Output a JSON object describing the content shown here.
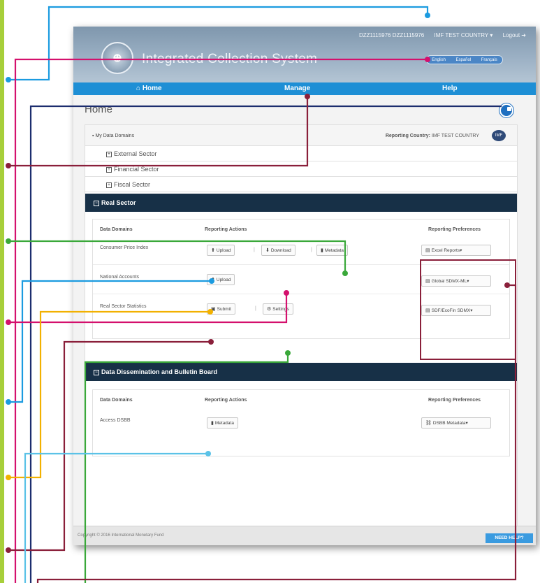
{
  "header": {
    "user_id": "DZZ1115976 DZZ1115976",
    "country_menu": "IMF TEST COUNTRY",
    "logout": "Logout",
    "app_title": "Integrated Collection System",
    "languages": [
      "English",
      "Español",
      "Français"
    ]
  },
  "nav": {
    "home": "Home",
    "manage": "Manage",
    "help": "Help"
  },
  "page": {
    "title": "Home"
  },
  "panel": {
    "domains_label": "My Data Domains",
    "reporting_country_label": "Reporting Country:",
    "reporting_country_value": "IMF TEST COUNTRY",
    "collapsed_sectors": [
      "External Sector",
      "Financial Sector",
      "Fiscal Sector"
    ],
    "expanded_sector": "Real Sector"
  },
  "real_sector_table": {
    "headers": {
      "domains": "Data Domains",
      "actions": "Reporting Actions",
      "prefs": "Reporting Preferences"
    },
    "rows": [
      {
        "label": "Consumer Price Index",
        "actions": [
          "Upload",
          "Download",
          "Metadata"
        ],
        "pref": "Excel Reports"
      },
      {
        "label": "National Accounts",
        "actions": [
          "Upload"
        ],
        "pref": "Global SDMX-ML"
      },
      {
        "label": "Real Sector Statistics",
        "actions": [
          "Submit",
          "Settings"
        ],
        "pref": "SDF/EcoFin SDMX"
      }
    ]
  },
  "dissemination": {
    "title": "Data Dissemination and Bulletin Board",
    "headers": {
      "domains": "Data Domains",
      "actions": "Reporting Actions",
      "prefs": "Reporting Preferences"
    },
    "rows": [
      {
        "label": "Access DSBB",
        "actions": [
          "Metadata"
        ],
        "pref": "DSBB Metadata"
      }
    ]
  },
  "footer": {
    "copyright": "Copyright © 2016 International Monetary Fund",
    "need_help": "NEED HELP?"
  },
  "icons": {
    "home": "home-icon",
    "doc": "document-icon",
    "upload": "upload-icon",
    "download": "download-icon",
    "metadata": "book-icon",
    "submit": "submit-icon",
    "settings": "gear-icon",
    "file": "file-icon"
  },
  "colors": {
    "nav": "#1e8fd5",
    "dark_bar": "#173047",
    "cyan": "#1b9be0",
    "magenta": "#d4106d",
    "maroon": "#8a1f3a",
    "navy": "#1c2d6e",
    "green": "#3aa83a",
    "yellow": "#f2b100",
    "light_blue": "#5bc2e7",
    "left_rail": "#a7cf3a"
  }
}
